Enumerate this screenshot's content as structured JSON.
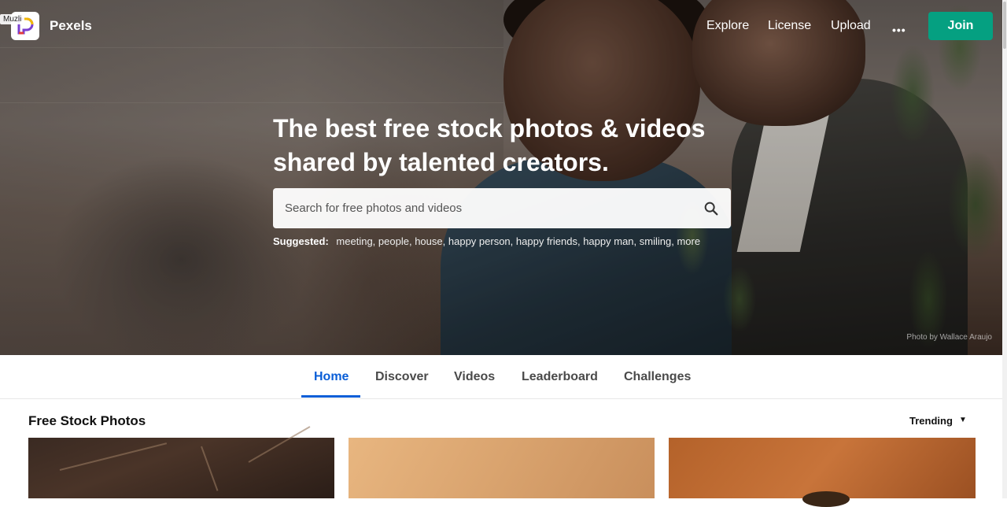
{
  "app": {
    "brand": "Pexels",
    "extension_tag": "Muzli"
  },
  "nav": {
    "links": [
      "Explore",
      "License",
      "Upload"
    ],
    "more_label": "•••",
    "join_label": "Join"
  },
  "hero": {
    "headline_line1": "The best free stock photos & videos",
    "headline_line2": "shared by talented creators.",
    "search_placeholder": "Search for free photos and videos",
    "suggested_label": "Suggested:",
    "suggested_tags": [
      "meeting,",
      "people,",
      "house,",
      "happy person,",
      "happy friends,",
      "happy man,",
      "smiling,",
      "more"
    ],
    "credit": "Photo by Wallace Araujo"
  },
  "tabs": [
    "Home",
    "Discover",
    "Videos",
    "Leaderboard",
    "Challenges"
  ],
  "active_tab": "Home",
  "section": {
    "title": "Free Stock Photos",
    "sort_label": "Trending"
  },
  "colors": {
    "accent": "#05a081",
    "tab_active": "#0a5ed7"
  }
}
